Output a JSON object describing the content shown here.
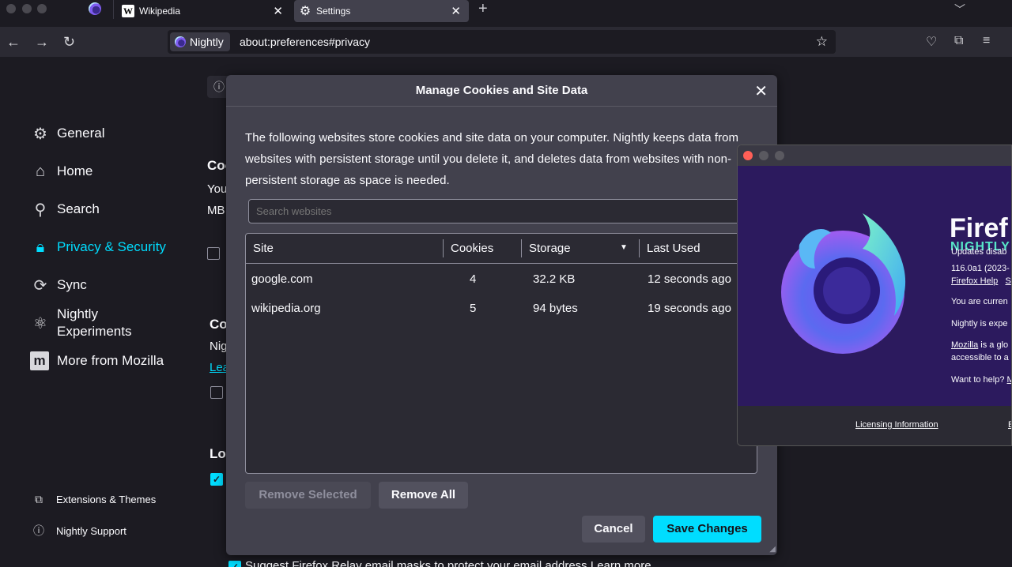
{
  "browser": {
    "tabs": [
      {
        "title": "Wikipedia",
        "favicon": "W",
        "active": false
      },
      {
        "title": "Settings",
        "favicon": "gear",
        "active": true
      }
    ],
    "identity_label": "Nightly",
    "url": "about:preferences#privacy"
  },
  "sidebar": {
    "items": [
      {
        "label": "General",
        "icon": "gear-icon"
      },
      {
        "label": "Home",
        "icon": "home-icon"
      },
      {
        "label": "Search",
        "icon": "search-icon"
      },
      {
        "label": "Privacy & Security",
        "icon": "lock-icon",
        "selected": true
      },
      {
        "label": "Sync",
        "icon": "sync-icon"
      },
      {
        "label_line1": "Nightly",
        "label_line2": "Experiments",
        "icon": "experiments-icon"
      },
      {
        "label": "More from Mozilla",
        "icon": "mozilla-icon"
      }
    ],
    "bottom": [
      {
        "label": "Extensions & Themes",
        "icon": "puzzle-icon"
      },
      {
        "label": "Nightly Support",
        "icon": "help-icon"
      }
    ]
  },
  "background_fragments": {
    "cookies_heading": "Coo",
    "cookies_line1": "You",
    "cookies_line2": "MB",
    "container_heading": "Co",
    "container_line1": "Nig",
    "container_link": "Lea",
    "logins_heading": "Lo",
    "relay_text": "Suggest Firefox Relay email masks to protect your email address   Learn more"
  },
  "dialog": {
    "title": "Manage Cookies and Site Data",
    "description": "The following websites store cookies and site data on your computer. Nightly keeps data from websites with persistent storage until you delete it, and deletes data from websites with non-persistent storage as space is needed.",
    "search_placeholder": "Search websites",
    "columns": {
      "site": "Site",
      "cookies": "Cookies",
      "storage": "Storage",
      "last_used": "Last Used"
    },
    "rows": [
      {
        "site": "google.com",
        "cookies": "4",
        "storage": "32.2 KB",
        "last_used": "12 seconds ago"
      },
      {
        "site": "wikipedia.org",
        "cookies": "5",
        "storage": "94 bytes",
        "last_used": "19 seconds ago"
      }
    ],
    "remove_selected": "Remove Selected",
    "remove_all": "Remove All",
    "cancel": "Cancel",
    "save": "Save Changes"
  },
  "about_window": {
    "brand_name": "Firef",
    "brand_channel": "NIGHTLY",
    "updates_text": "Updates disab",
    "version_text": "116.0a1 (2023-",
    "help_link": "Firefox Help",
    "help_link_cut": "S",
    "current_text": "You are curren",
    "experimental_text": "Nightly is expe",
    "mozilla_link": "Mozilla",
    "mozilla_text": " is a glo",
    "accessible_text": "accessible to a",
    "want_help_text": "Want to help? ",
    "want_help_link": "M",
    "licensing_link": "Licensing Information",
    "footer_cut": "E"
  },
  "colors": {
    "accent": "#00ddff",
    "dialog_bg": "#42414d",
    "page_bg": "#1c1b22",
    "nightly_teal": "#57e6c8",
    "about_bg": "#2c1a5e"
  }
}
